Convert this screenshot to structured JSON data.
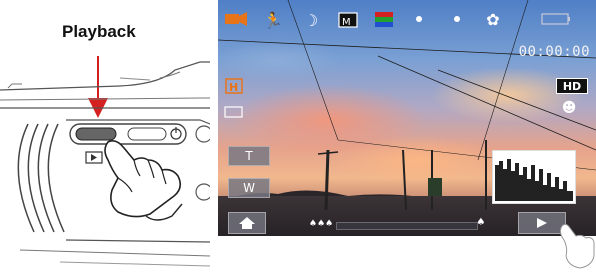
{
  "callout": {
    "label": "Playback"
  },
  "screen": {
    "timer": "00:00:00",
    "quality_badge": "HD",
    "zoom_tele_label": "T",
    "zoom_wide_label": "W"
  },
  "topbar_icons": [
    "video-mode-icon",
    "scene-sports-icon",
    "night-mode-icon",
    "auto-mode-icon",
    "color-effect-icon",
    "dot-icon",
    "dot-icon",
    "macro-flower-icon",
    "battery-icon"
  ],
  "colors": {
    "accent_orange": "#e8741a",
    "indicator_red": "#d42020",
    "button_gray": "#6e6e78"
  }
}
